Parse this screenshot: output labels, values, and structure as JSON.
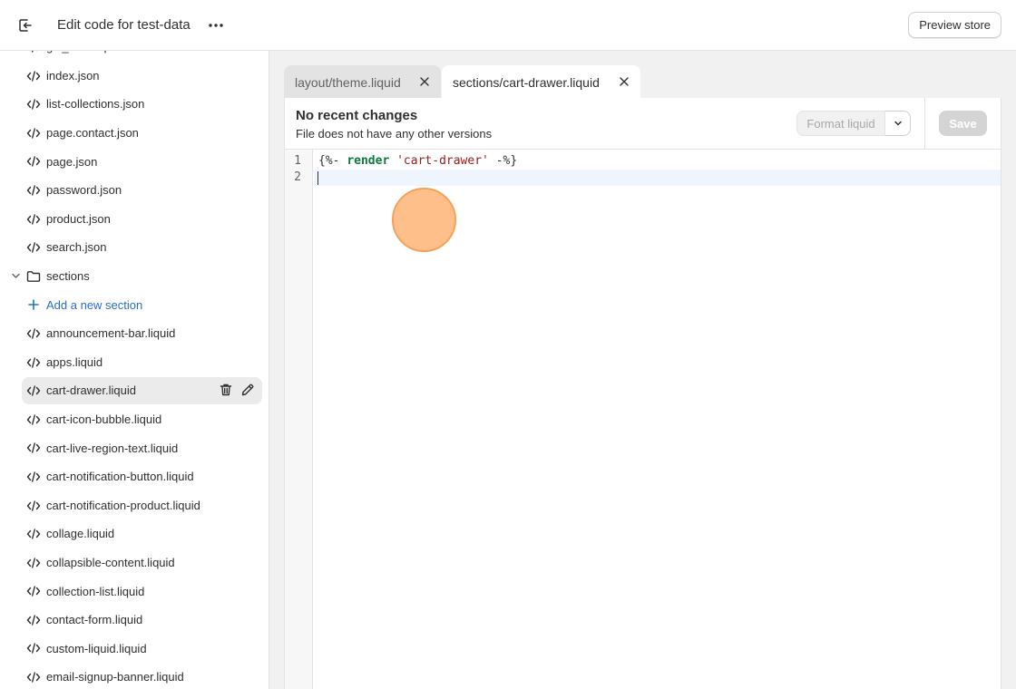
{
  "header": {
    "title": "Edit code for test-data",
    "preview_label": "Preview store"
  },
  "sidebar": {
    "partial_item": "gift_card.liquid",
    "items": [
      {
        "label": "index.json",
        "type": "file"
      },
      {
        "label": "list-collections.json",
        "type": "file"
      },
      {
        "label": "page.contact.json",
        "type": "file"
      },
      {
        "label": "page.json",
        "type": "file"
      },
      {
        "label": "password.json",
        "type": "file"
      },
      {
        "label": "product.json",
        "type": "file"
      },
      {
        "label": "search.json",
        "type": "file"
      },
      {
        "label": "sections",
        "type": "folder"
      },
      {
        "label": "Add a new section",
        "type": "add"
      },
      {
        "label": "announcement-bar.liquid",
        "type": "file"
      },
      {
        "label": "apps.liquid",
        "type": "file"
      },
      {
        "label": "cart-drawer.liquid",
        "type": "file",
        "selected": true
      },
      {
        "label": "cart-icon-bubble.liquid",
        "type": "file"
      },
      {
        "label": "cart-live-region-text.liquid",
        "type": "file"
      },
      {
        "label": "cart-notification-button.liquid",
        "type": "file"
      },
      {
        "label": "cart-notification-product.liquid",
        "type": "file"
      },
      {
        "label": "collage.liquid",
        "type": "file"
      },
      {
        "label": "collapsible-content.liquid",
        "type": "file"
      },
      {
        "label": "collection-list.liquid",
        "type": "file"
      },
      {
        "label": "contact-form.liquid",
        "type": "file"
      },
      {
        "label": "custom-liquid.liquid",
        "type": "file"
      },
      {
        "label": "email-signup-banner.liquid",
        "type": "file"
      }
    ]
  },
  "tabs": [
    {
      "label": "layout/theme.liquid",
      "active": false
    },
    {
      "prefix": "sections/",
      "name": "cart-drawer.liquid",
      "active": true
    }
  ],
  "editor": {
    "status_title": "No recent changes",
    "status_subtitle": "File does not have any other versions",
    "format_label": "Format liquid",
    "save_label": "Save",
    "line_numbers": [
      "1",
      "2"
    ],
    "code": {
      "open": "{%-",
      "keyword": "render",
      "string": "'cart-drawer'",
      "close": "-%}"
    }
  },
  "icons": {
    "exit": "exit-icon",
    "more": "more-horizontal-icon",
    "file": "code-file-icon",
    "folder": "folder-icon",
    "add": "plus-icon",
    "delete": "trash-icon",
    "rename": "pencil-icon",
    "close": "close-icon",
    "dropdown": "chevron-down-icon"
  },
  "colors": {
    "accent": "#2c6ecb",
    "keyword": "#0c7a3f",
    "string": "#a01b1b",
    "click_marker": "#f5a15a"
  }
}
